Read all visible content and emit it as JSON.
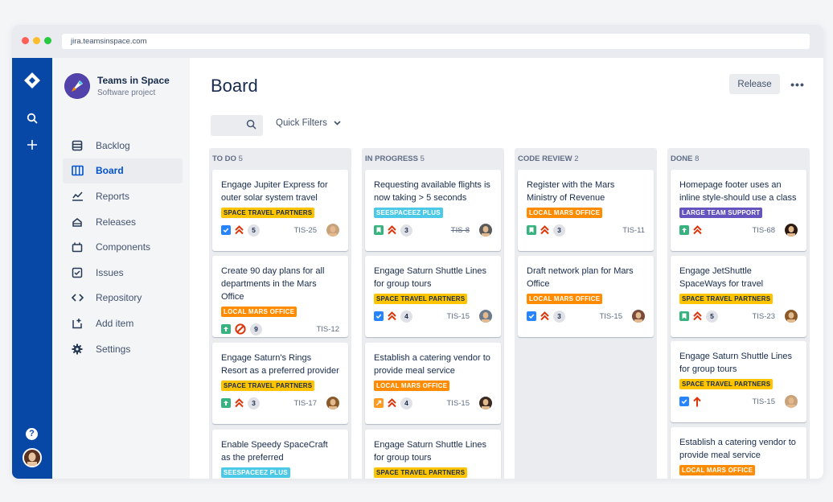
{
  "browser": {
    "url": "jira.teamsinspace.com"
  },
  "project": {
    "name": "Teams in Space",
    "type": "Software project"
  },
  "nav": [
    {
      "label": "Backlog",
      "icon": "backlog-icon"
    },
    {
      "label": "Board",
      "icon": "board-icon",
      "active": true
    },
    {
      "label": "Reports",
      "icon": "reports-icon"
    },
    {
      "label": "Releases",
      "icon": "releases-icon"
    },
    {
      "label": "Components",
      "icon": "components-icon"
    },
    {
      "label": "Issues",
      "icon": "issues-icon"
    },
    {
      "label": "Repository",
      "icon": "repository-icon"
    },
    {
      "label": "Add item",
      "icon": "add-item-icon"
    },
    {
      "label": "Settings",
      "icon": "settings-icon"
    }
  ],
  "board": {
    "title": "Board",
    "release_label": "Release",
    "more_label": "•••",
    "quick_filters": "Quick Filters"
  },
  "help_label": "?",
  "colors": {
    "blue_nav": "#0747a6",
    "yellow": "#ffc400",
    "orange": "#ff8b00",
    "teal": "#4cc9e6",
    "purple": "#6554c0",
    "green": "#36b37e",
    "red": "#de350b"
  },
  "columns": [
    {
      "name": "TO DO",
      "count": "5",
      "cards": [
        {
          "title": "Engage Jupiter Express for outer solar system travel",
          "label": "SPACE TRAVEL PARTNERS",
          "label_color": "#ffc400",
          "label_text": "#172b4d",
          "type": "task",
          "priority": "highest",
          "estimate": "5",
          "key": "TIS-25",
          "avatar": "#c8a27a"
        },
        {
          "title": "Create 90 day plans for all departments in the Mars Office",
          "label": "LOCAL MARS OFFICE",
          "label_color": "#ff8b00",
          "label_text": "#ffffff",
          "type": "improvement",
          "priority": "blocker",
          "estimate": "9",
          "key": "TIS-12",
          "avatar": ""
        },
        {
          "title": "Engage Saturn's Rings Resort as a preferred provider",
          "label": "SPACE TRAVEL PARTNERS",
          "label_color": "#ffc400",
          "label_text": "#172b4d",
          "type": "improvement",
          "priority": "highest",
          "estimate": "3",
          "key": "TIS-17",
          "avatar": "#8b5a2b"
        },
        {
          "title": "Enable Speedy SpaceCraft as the preferred",
          "label": "SEESPACEEZ PLUS",
          "label_color": "#4cc9e6",
          "label_text": "#ffffff",
          "type": "",
          "priority": "",
          "estimate": "",
          "key": "",
          "avatar": ""
        }
      ]
    },
    {
      "name": "IN PROGRESS",
      "count": "5",
      "cards": [
        {
          "title": "Requesting available flights is now taking > 5 seconds",
          "label": "SEESPACEEZ PLUS",
          "label_color": "#4cc9e6",
          "label_text": "#ffffff",
          "type": "story",
          "priority": "highest",
          "estimate": "3",
          "key": "TIS-8",
          "key_strike": true,
          "avatar": "#5a5a5a"
        },
        {
          "title": "Engage Saturn Shuttle Lines for group tours",
          "label": "SPACE TRAVEL PARTNERS",
          "label_color": "#ffc400",
          "label_text": "#172b4d",
          "type": "task",
          "priority": "highest",
          "estimate": "4",
          "key": "TIS-15",
          "avatar": "#6b7b8c"
        },
        {
          "title": "Establish a catering vendor to provide meal service",
          "label": "LOCAL MARS OFFICE",
          "label_color": "#ff8b00",
          "label_text": "#ffffff",
          "type": "subtask",
          "priority": "highest",
          "estimate": "4",
          "key": "TIS-15",
          "avatar": "#3a2a22"
        },
        {
          "title": "Engage Saturn Shuttle Lines for group tours",
          "label": "SPACE TRAVEL PARTNERS",
          "label_color": "#ffc400",
          "label_text": "#172b4d",
          "type": "",
          "priority": "",
          "estimate": "",
          "key": "",
          "avatar": ""
        }
      ]
    },
    {
      "name": "CODE REVIEW",
      "count": "2",
      "cards": [
        {
          "title": "Register with the Mars Ministry of Revenue",
          "label": "LOCAL MARS OFFICE",
          "label_color": "#ff8b00",
          "label_text": "#ffffff",
          "type": "story",
          "priority": "highest",
          "estimate": "3",
          "key": "TIS-11",
          "avatar": ""
        },
        {
          "title": "Draft network plan for Mars Office",
          "label": "LOCAL MARS OFFICE",
          "label_color": "#ff8b00",
          "label_text": "#ffffff",
          "type": "task",
          "priority": "highest",
          "estimate": "3",
          "key": "TIS-15",
          "avatar": "#7a4a3a"
        }
      ]
    },
    {
      "name": "DONE",
      "count": "8",
      "cards": [
        {
          "title": "Homepage footer uses an inline style-should use a class",
          "label": "LARGE TEAM SUPPORT",
          "label_color": "#6554c0",
          "label_text": "#ffffff",
          "type": "improvement",
          "priority": "highest",
          "estimate": "",
          "key": "TIS-68",
          "avatar": "#2a1a12"
        },
        {
          "title": "Engage JetShuttle SpaceWays for travel",
          "label": "SPACE TRAVEL PARTNERS",
          "label_color": "#ffc400",
          "label_text": "#172b4d",
          "type": "story",
          "priority": "highest",
          "estimate": "5",
          "key": "TIS-23",
          "avatar": "#8b5a2b"
        },
        {
          "title": "Engage Saturn Shuttle Lines for group tours",
          "label": "SPACE TRAVEL PARTNERS",
          "label_color": "#ffc400",
          "label_text": "#172b4d",
          "type": "task",
          "priority": "high",
          "estimate": "",
          "key": "TIS-15",
          "avatar": "#c8a27a"
        },
        {
          "title": "Establish a catering vendor to provide meal service",
          "label": "LOCAL MARS OFFICE",
          "label_color": "#ff8b00",
          "label_text": "#ffffff",
          "type": "",
          "priority": "",
          "estimate": "",
          "key": "",
          "avatar": ""
        }
      ]
    }
  ]
}
